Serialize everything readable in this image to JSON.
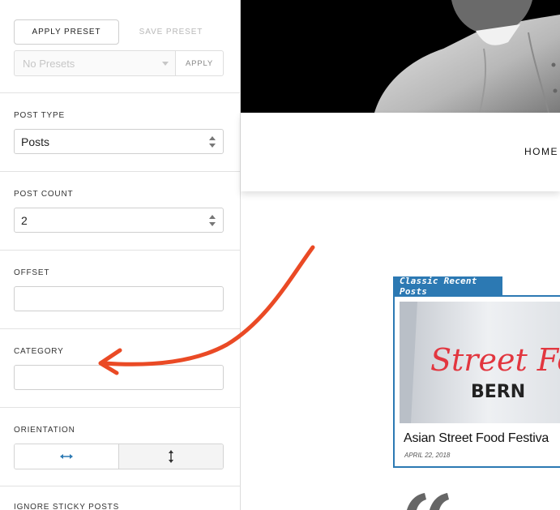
{
  "presets": {
    "apply_preset_label": "APPLY PRESET",
    "save_preset_label": "SAVE PRESET",
    "select_value": "No Presets",
    "apply_label": "APPLY"
  },
  "post_type": {
    "label": "POST TYPE",
    "value": "Posts"
  },
  "post_count": {
    "label": "POST COUNT",
    "value": "2"
  },
  "offset": {
    "label": "OFFSET",
    "value": ""
  },
  "category": {
    "label": "CATEGORY",
    "value": ""
  },
  "orientation": {
    "label": "ORIENTATION",
    "options": [
      {
        "icon": "horizontal-arrow-icon",
        "active": true
      },
      {
        "icon": "vertical-arrow-icon",
        "active": false
      }
    ]
  },
  "ignore_sticky": {
    "label": "IGNORE STICKY POSTS"
  },
  "preview": {
    "nav_home": "HOME",
    "widget_title": "Classic Recent Posts",
    "thumb_text_top": "Street Fo",
    "thumb_text_bottom": "BERN",
    "post_title": "Asian Street Food Festiva",
    "post_date": "APRIL 22, 2018"
  },
  "colors": {
    "accent_blue": "#2c79b3",
    "annotation_arrow": "#ea4a25",
    "orientation_icon_active": "#2c79b3"
  }
}
